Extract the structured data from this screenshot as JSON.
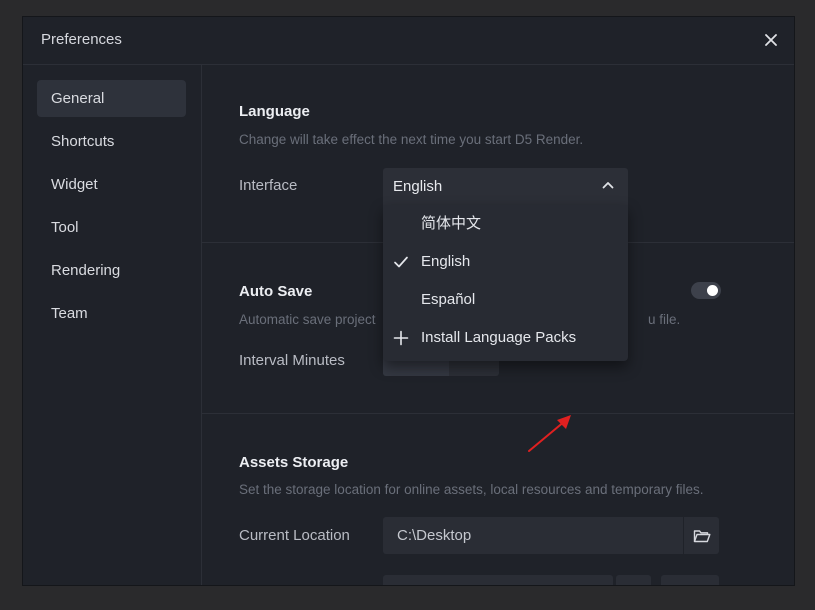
{
  "window": {
    "title": "Preferences"
  },
  "sidebar": {
    "items": [
      {
        "label": "General",
        "active": true
      },
      {
        "label": "Shortcuts"
      },
      {
        "label": "Widget"
      },
      {
        "label": "Tool"
      },
      {
        "label": "Rendering"
      },
      {
        "label": "Team"
      }
    ]
  },
  "language": {
    "title": "Language",
    "description": "Change will take effect the next time you start D5 Render.",
    "interface_label": "Interface",
    "selected": "English",
    "options": [
      {
        "label": "简体中文",
        "icon": "none"
      },
      {
        "label": "English",
        "icon": "check-icon",
        "checked": true
      },
      {
        "label": "Español",
        "icon": "none"
      },
      {
        "label": "Install Language Packs",
        "icon": "plus-icon"
      }
    ]
  },
  "auto_save": {
    "title": "Auto Save",
    "description_visible_start": "Automatic save project",
    "description_visible_end": "u file.",
    "interval_label": "Interval Minutes",
    "enabled": true
  },
  "assets_storage": {
    "title": "Assets Storage",
    "description": "Set the storage location for online assets, local resources and temporary files.",
    "location_label": "Current Location",
    "location_value": "C:\\Desktop"
  },
  "colors": {
    "background": "#1f2229",
    "accent_arrow": "#e02020",
    "toggle_knob": "#ffffff"
  }
}
